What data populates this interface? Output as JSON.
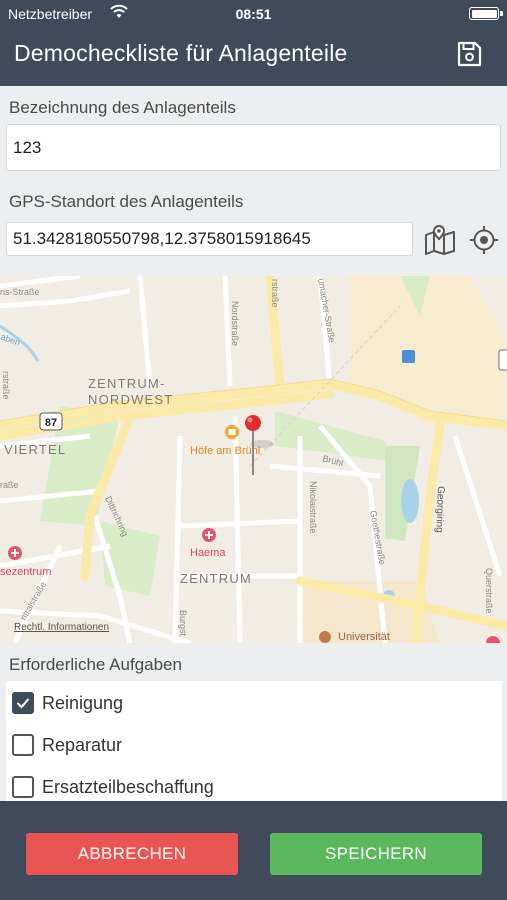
{
  "status_bar": {
    "carrier": "Netzbetreiber",
    "time": "08:51",
    "battery_level": 100
  },
  "header": {
    "title": "Democheckliste für Anlagenteile",
    "save_icon": "floppy-disk-icon"
  },
  "form": {
    "name_label": "Bezeichnung des Anlagenteils",
    "name_value": "123",
    "gps_label": "GPS-Standort des Anlagenteils",
    "gps_value": "51.3428180550798,12.3758015918645",
    "map_icon": "map-icon",
    "locate_icon": "crosshair-icon"
  },
  "map": {
    "labels": {
      "district_nw_1": "ZENTRUM-",
      "district_nw_2": "NORDWEST",
      "district_center": "ZENTRUM",
      "viertel": "VIERTEL",
      "route_badge": "87",
      "poi_hoefe": "Höfe am Brühl",
      "poi_haema": "Haema",
      "poi_sezentrum": "sezentrum",
      "poi_universitaet": "Universität",
      "street_nordstrasse": "Nordstraße",
      "street_rstrasse": "rstraße",
      "street_umacher": "umacher-Straße",
      "street_bruehl": "Brühl",
      "street_nikolai": "Nikolaistraße",
      "street_goethe": "Goethestraße",
      "street_georgiring": "Georgiring",
      "street_ditt": "Dittrichring",
      "street_burg": "Burgst",
      "street_quer": "Querstraße",
      "street_ns": "ns-Straße",
      "street_aben": "aben",
      "street_rstr_left": "rstraße",
      "street_rasse": "raße",
      "street_ntral": "ntralstraße",
      "legal": "Rechtl. Informationen"
    },
    "pin_icon": "map-pin-icon"
  },
  "tasks": {
    "section_label": "Erforderliche Aufgaben",
    "items": [
      {
        "label": "Reinigung",
        "checked": true
      },
      {
        "label": "Reparatur",
        "checked": false
      },
      {
        "label": "Ersatzteilbeschaffung",
        "checked": false
      }
    ]
  },
  "footer": {
    "cancel_label": "ABBRECHEN",
    "save_label": "SPEICHERN"
  },
  "colors": {
    "header_bg": "#3f4b5a",
    "cancel": "#e85552",
    "save": "#5cb85c"
  }
}
